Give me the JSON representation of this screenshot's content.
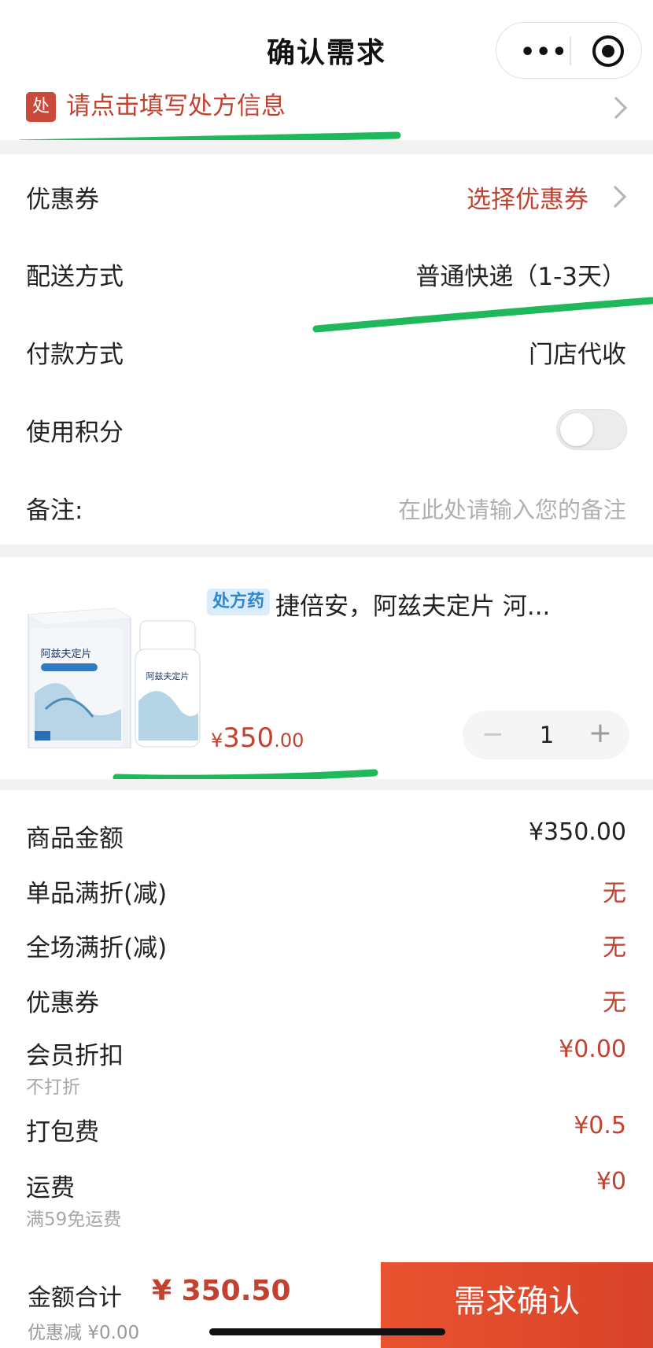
{
  "header": {
    "title": "确认需求",
    "more_icon": "more-dots-icon",
    "close_icon": "target-icon"
  },
  "prescription": {
    "badge": "处",
    "text": "请点击填写处方信息"
  },
  "rows": {
    "coupon": {
      "label": "优惠券",
      "value": "选择优惠券"
    },
    "delivery": {
      "label": "配送方式",
      "value": "普通快递（1-3天）"
    },
    "payment": {
      "label": "付款方式",
      "value": "门店代收"
    },
    "points": {
      "label": "使用积分",
      "enabled": false
    },
    "note": {
      "label": "备注:",
      "placeholder": "在此处请输入您的备注"
    }
  },
  "product": {
    "tag": "处方药",
    "name": "捷倍安，阿兹夫定片 河...",
    "price_currency": "¥",
    "price_int": "350",
    "price_dec": ".00",
    "quantity": "1",
    "box_title": "阿兹夫定片",
    "bottle_title": "阿兹夫定片"
  },
  "summary": [
    {
      "label": "商品金额",
      "value": "¥350.00",
      "dark": true
    },
    {
      "label": "单品满折(减)",
      "value": "无"
    },
    {
      "label": "全场满折(减)",
      "value": "无"
    },
    {
      "label": "优惠券",
      "value": "无"
    },
    {
      "label": "会员折扣",
      "sub": "不打折",
      "value": "¥0.00"
    },
    {
      "label": "打包费",
      "value": "¥0.5"
    },
    {
      "label": "运费",
      "sub": "满59免运费",
      "value": "¥0"
    }
  ],
  "bottom": {
    "total_label": "金额合计",
    "total_value": "¥ 350.50",
    "discount": "优惠减 ¥0.00",
    "confirm_label": "需求确认"
  },
  "colors": {
    "accent_red": "#c2412f",
    "button_red": "#e9532f",
    "marker_green": "#1fb85a"
  }
}
